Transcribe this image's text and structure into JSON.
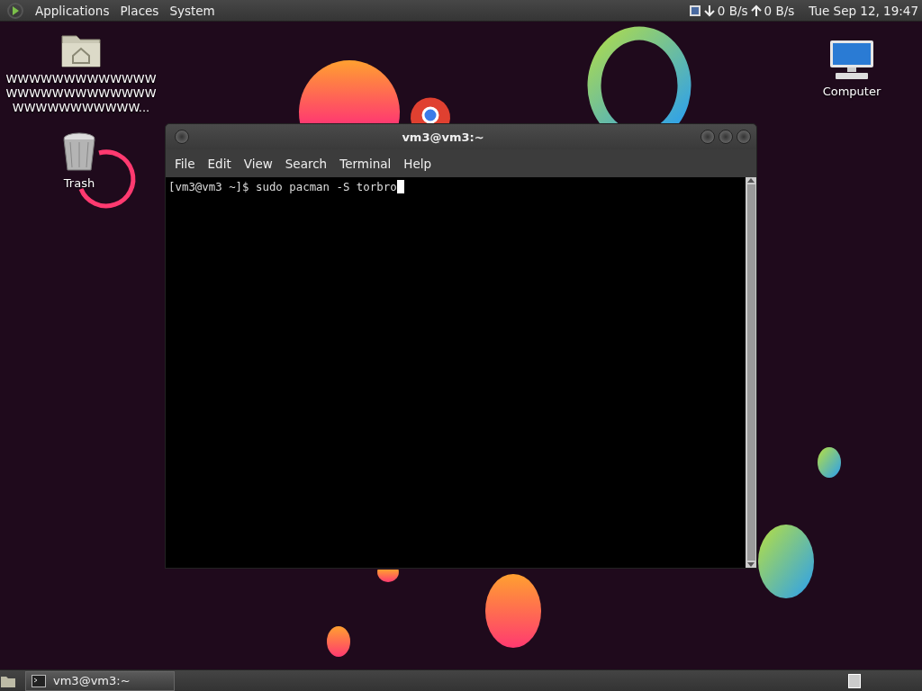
{
  "top_panel": {
    "menus": [
      "Applications",
      "Places",
      "System"
    ],
    "download_rate": "0 B/s",
    "upload_rate": "0 B/s",
    "clock": "Tue Sep 12, 19:47"
  },
  "desktop_icons": [
    {
      "kind": "home",
      "label": "WWWWWWWWWWWWW\nWWWWWWWWWWWWW\nWWWWWWWWWWW..."
    },
    {
      "kind": "trash",
      "label": "Trash"
    },
    {
      "kind": "computer",
      "label": "Computer"
    }
  ],
  "terminal": {
    "title": "vm3@vm3:~",
    "menu": [
      "File",
      "Edit",
      "View",
      "Search",
      "Terminal",
      "Help"
    ],
    "lines": [
      "[vm3@vm3 ~]$ sudo pacman -S torbro"
    ]
  },
  "taskbar": {
    "tasks": [
      {
        "label": "vm3@vm3:~",
        "selected": true
      }
    ]
  }
}
